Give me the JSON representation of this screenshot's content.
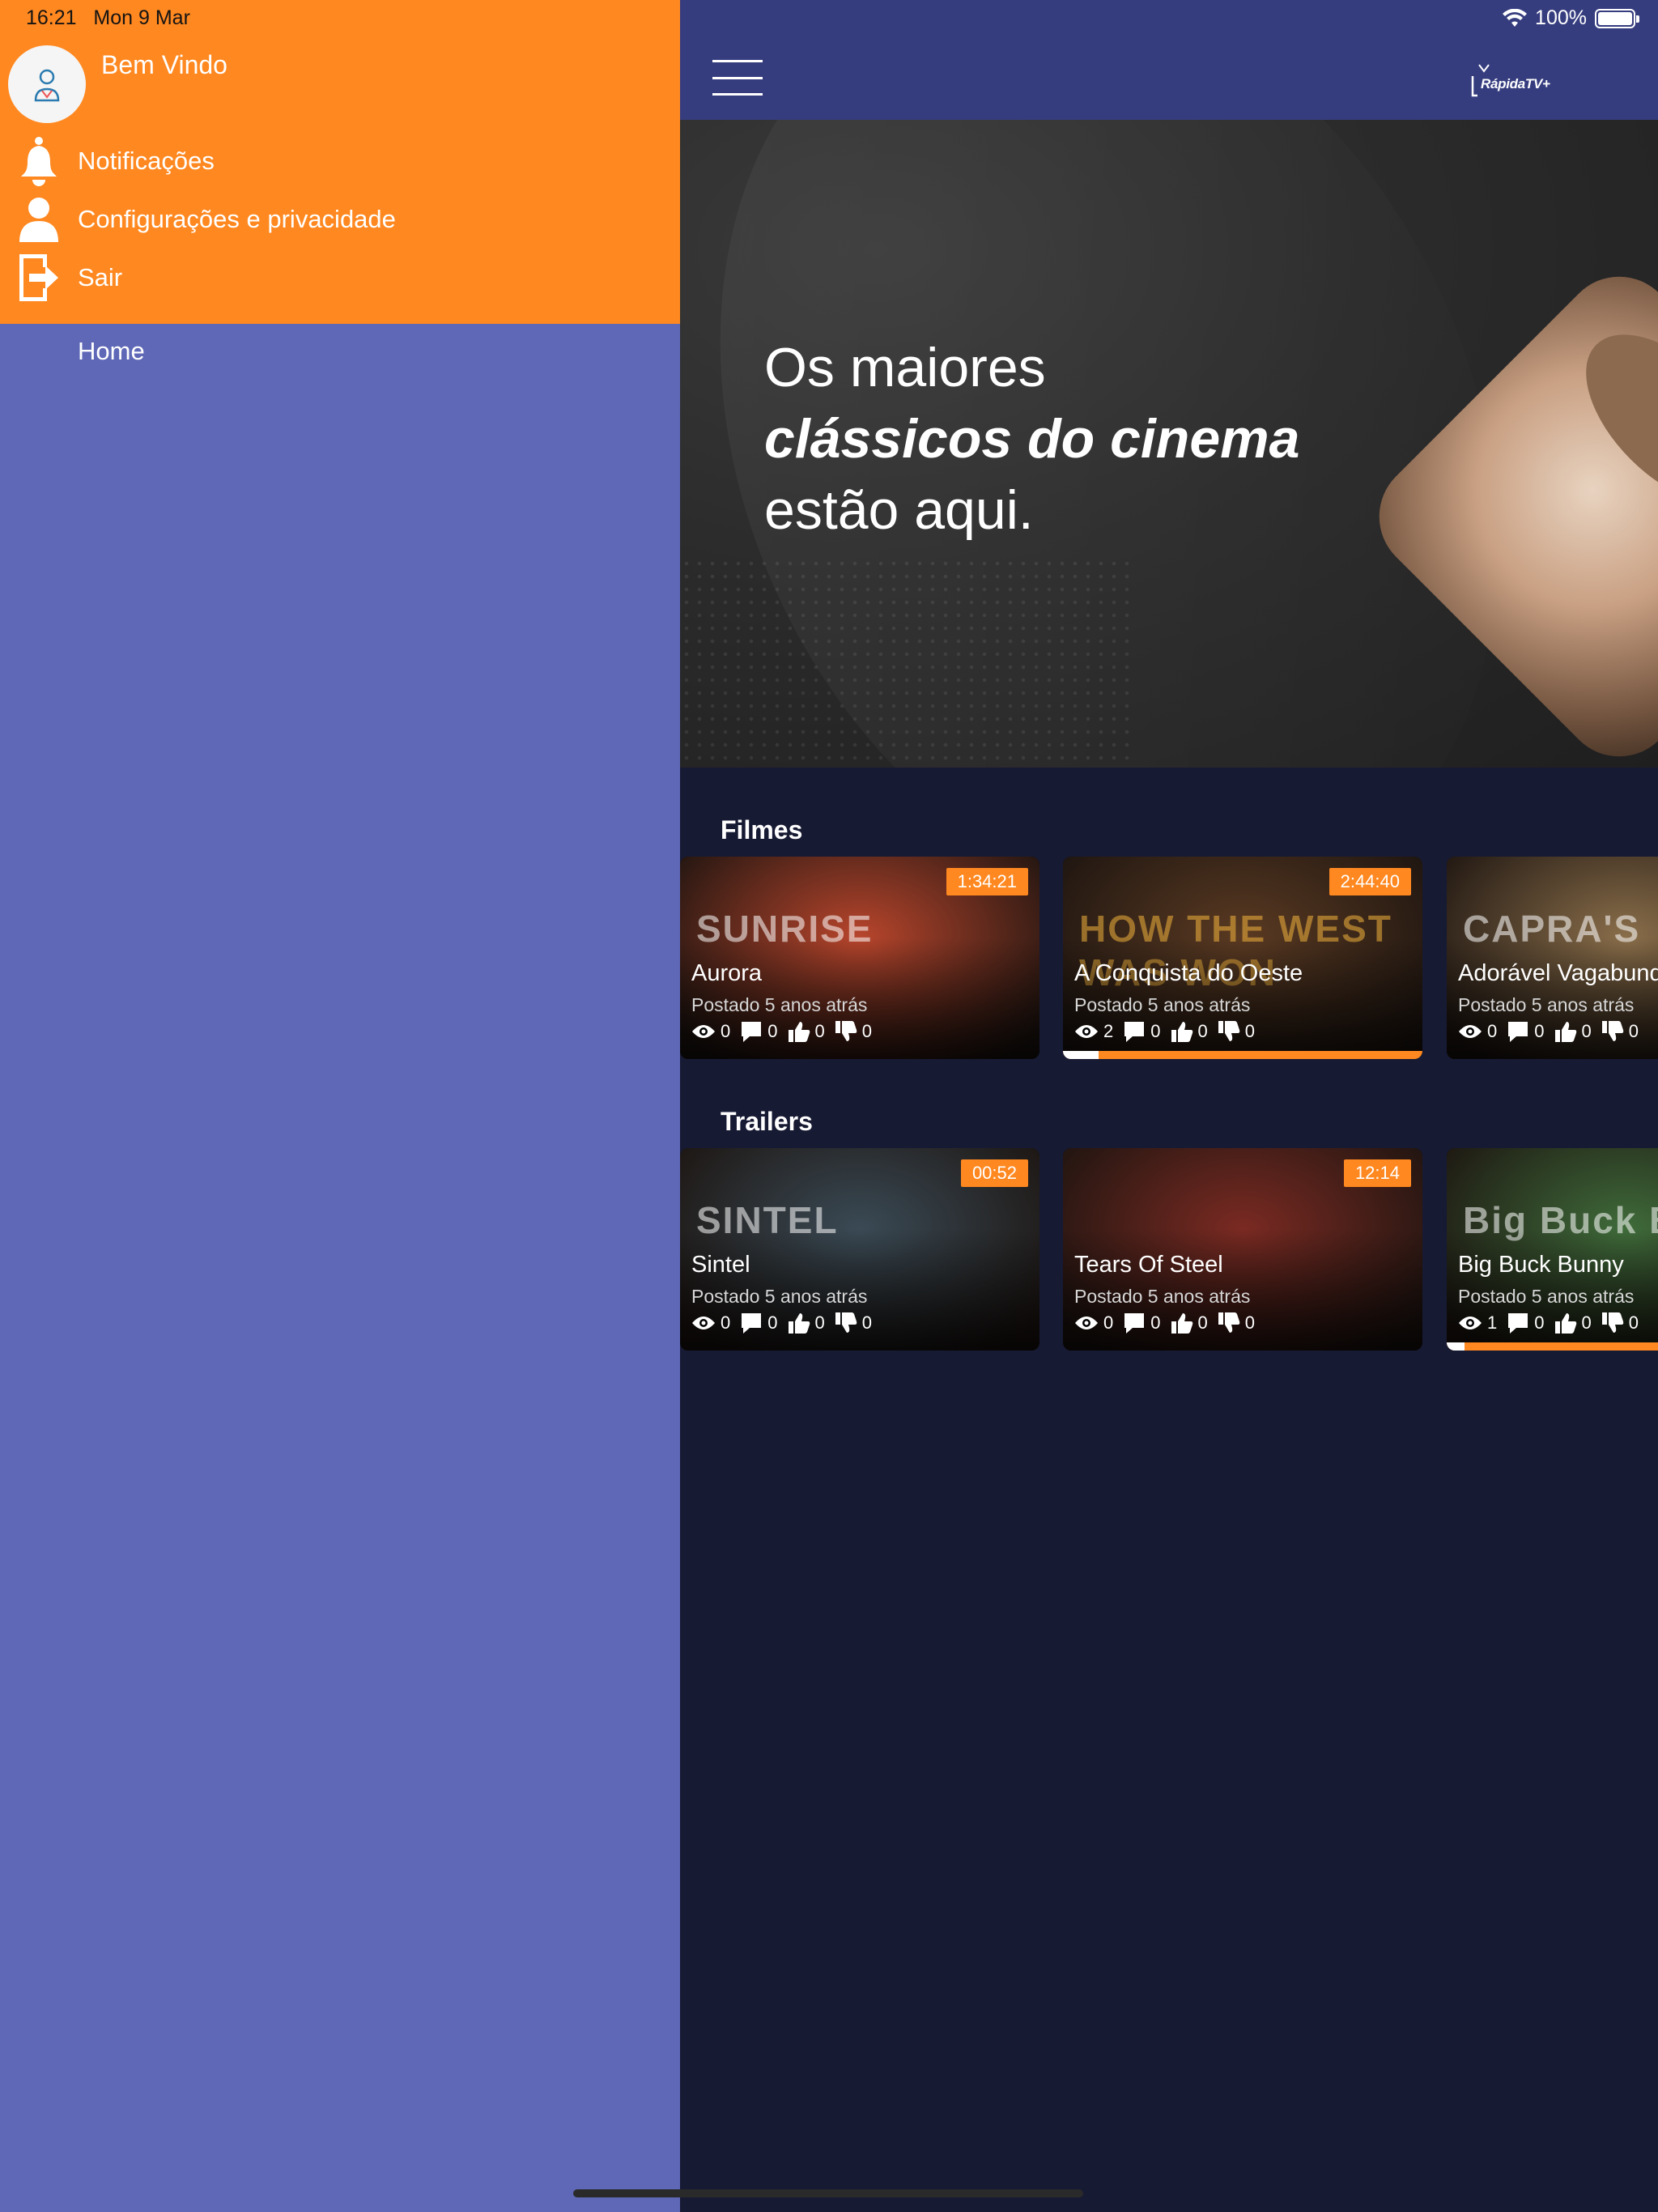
{
  "status_bar": {
    "time": "16:21",
    "date": "Mon 9 Mar",
    "battery": "100%"
  },
  "drawer": {
    "welcome": "Bem Vindo",
    "items": [
      {
        "label": "Notificações",
        "icon": "bell-icon"
      },
      {
        "label": "Configurações e privacidade",
        "icon": "user-icon"
      },
      {
        "label": "Sair",
        "icon": "logout-icon"
      }
    ],
    "nav": [
      {
        "label": "Home"
      }
    ]
  },
  "header": {
    "logo": "RápidaTV+"
  },
  "banner": {
    "line1": "Os maiores",
    "line2": "clássicos do cinema",
    "line3": "estão aqui."
  },
  "sections": [
    {
      "title": "Filmes",
      "cards": [
        {
          "title": "Aurora",
          "duration": "1:34:21",
          "posted": "Postado 5 anos atrás",
          "views": "0",
          "comments": "0",
          "likes": "0",
          "dislikes": "0",
          "progress": 0,
          "thumb_text": "SUNRISE",
          "accent": "#b8452c"
        },
        {
          "title": "A Conquista do Oeste",
          "duration": "2:44:40",
          "posted": "Postado 5 anos atrás",
          "views": "2",
          "comments": "0",
          "likes": "0",
          "dislikes": "0",
          "progress": 0.1,
          "thumb_text": "HOW THE WEST WAS WON",
          "accent": "#5a3a22"
        },
        {
          "title": "Adorável Vagabundo",
          "duration": "",
          "posted": "Postado 5 anos atrás",
          "views": "0",
          "comments": "0",
          "likes": "0",
          "dislikes": "0",
          "progress": 0,
          "thumb_text": "CAPRA'S",
          "accent": "#8a6e4a"
        }
      ]
    },
    {
      "title": "Trailers",
      "cards": [
        {
          "title": "Sintel",
          "duration": "00:52",
          "posted": "Postado 5 anos atrás",
          "views": "0",
          "comments": "0",
          "likes": "0",
          "dislikes": "0",
          "progress": 0,
          "thumb_text": "SINTEL",
          "accent": "#3a4a55"
        },
        {
          "title": "Tears Of Steel",
          "duration": "12:14",
          "posted": "Postado 5 anos atrás",
          "views": "0",
          "comments": "0",
          "likes": "0",
          "dislikes": "0",
          "progress": 0,
          "thumb_text": "",
          "accent": "#7a2a22"
        },
        {
          "title": "Big Buck Bunny",
          "duration": "",
          "posted": "Postado 5 anos atrás",
          "views": "1",
          "comments": "0",
          "likes": "0",
          "dislikes": "0",
          "progress": 0.05,
          "thumb_text": "Big Buck BUNNY",
          "accent": "#3f6b3a"
        }
      ]
    }
  ],
  "colors": {
    "drawer_header": "#ff8820",
    "drawer_body": "#5e68b7",
    "topbar": "#363d7f",
    "main_bg": "#171a33",
    "accent": "#ff8820"
  }
}
